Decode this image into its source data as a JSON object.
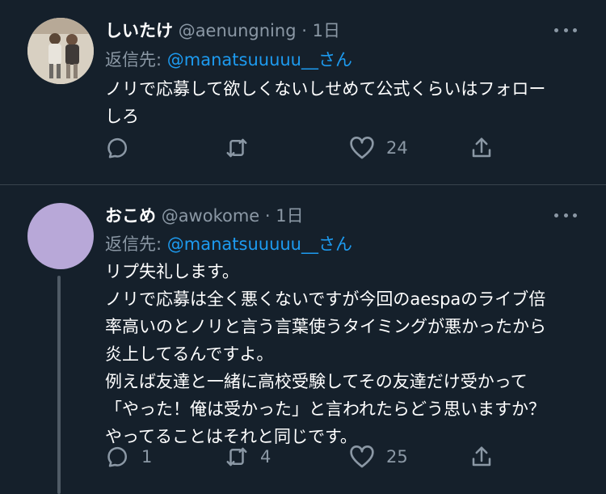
{
  "tweets": [
    {
      "display_name": "しいたけ",
      "handle": "@aenungning",
      "separator": "·",
      "time": "1日",
      "reply_prefix": "返信先: ",
      "reply_mention": "@manatsuuuuu__",
      "reply_suffix": "さん",
      "text": "ノリで応募して欲しくないしせめて公式くらいはフォロー\nしろ",
      "reply_count": "",
      "retweet_count": "",
      "like_count": "24",
      "avatar_color": "#c9c0b1"
    },
    {
      "display_name": "おこめ",
      "handle": "@awokome",
      "separator": "·",
      "time": "1日",
      "reply_prefix": "返信先: ",
      "reply_mention": "@manatsuuuuu__",
      "reply_suffix": "さん",
      "text": "リプ失礼します。\nノリで応募は全く悪くないですが今回のaespaのライブ倍\n率高いのとノリと言う言葉使うタイミングが悪かったから\n炎上してるんですよ。\n例えば友達と一緒に高校受験してその友達だけ受かって\n「やった！俺は受かった」と言われたらどう思いますか？\nやってることはそれと同じです。",
      "reply_count": "1",
      "retweet_count": "4",
      "like_count": "25",
      "avatar_color": "#b8a8d8"
    }
  ],
  "icons": [
    "reply-icon",
    "retweet-icon",
    "like-icon",
    "share-icon",
    "more-icon"
  ],
  "colors": {
    "background": "#15202b",
    "secondary_text": "#8b98a5",
    "link": "#1d9bf0",
    "divider": "#38444d"
  }
}
